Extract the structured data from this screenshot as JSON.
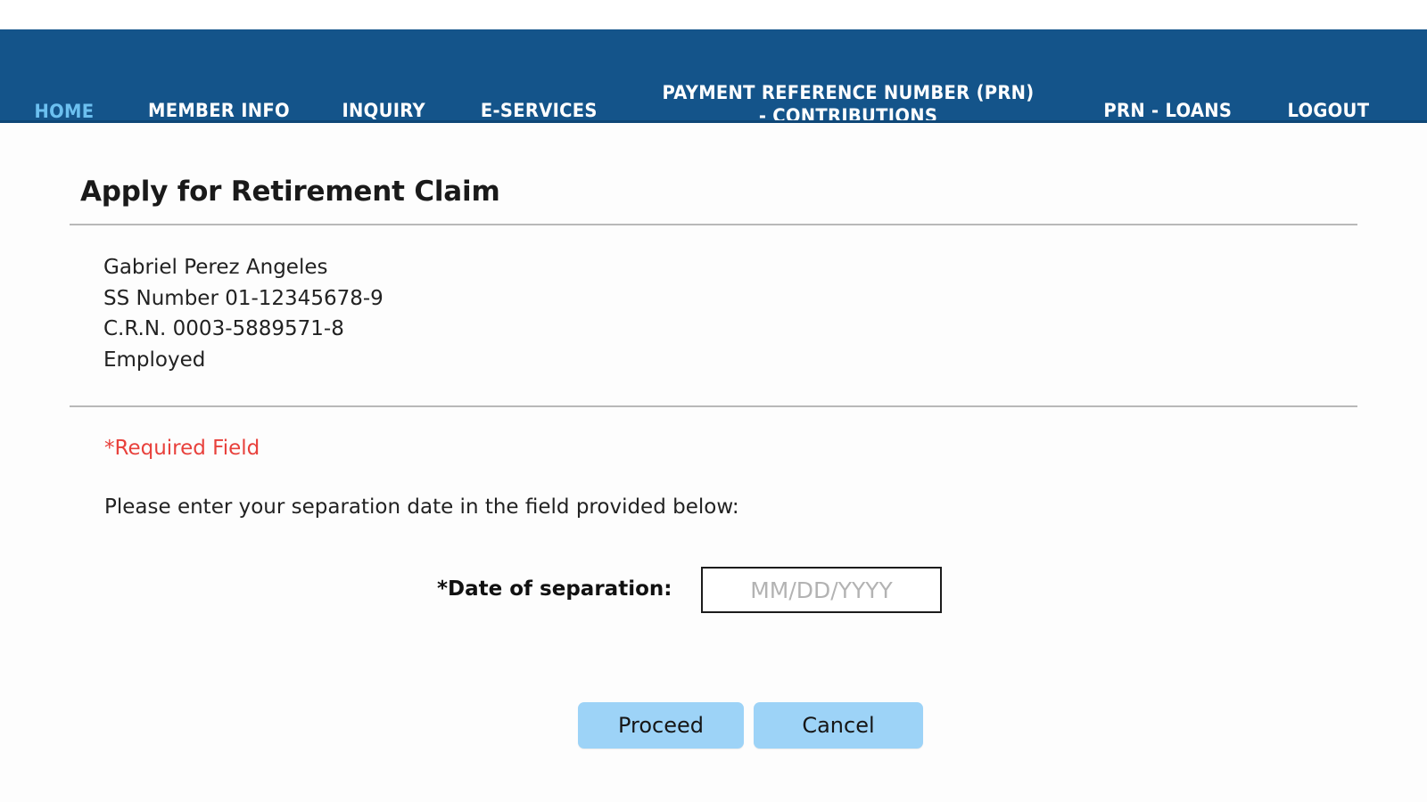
{
  "navbar": {
    "background_color": "#14548a",
    "active_color": "#6cc0f0",
    "items": [
      {
        "label": "HOME",
        "active": true
      },
      {
        "label": "MEMBER INFO",
        "active": false
      },
      {
        "label": "INQUIRY",
        "active": false
      },
      {
        "label": "E-SERVICES",
        "active": false
      },
      {
        "label": "PAYMENT REFERENCE NUMBER (PRN) - CONTRIBUTIONS",
        "active": false
      },
      {
        "label": "PRN - LOANS",
        "active": false
      },
      {
        "label": "LOGOUT",
        "active": false
      }
    ]
  },
  "main": {
    "page_title": "Apply for Retirement Claim",
    "member": {
      "name": "Gabriel Perez Angeles",
      "ss_number": "SS Number 01-12345678-9",
      "crn": "C.R.N. 0003-5889571-8",
      "status": "Employed"
    },
    "required_note": "*Required Field",
    "required_note_color": "#e8413c",
    "instruction": "Please enter your separation date in the field provided below:",
    "date_field": {
      "label": "*Date of separation:",
      "value": "",
      "placeholder": "MM/DD/YYYY"
    },
    "buttons": {
      "proceed_label": "Proceed",
      "cancel_label": "Cancel",
      "color": "#9dd3f7"
    }
  }
}
